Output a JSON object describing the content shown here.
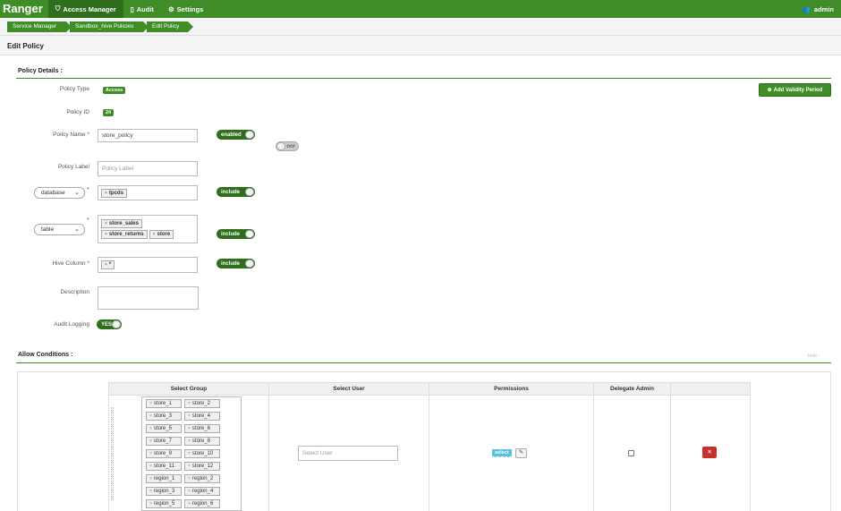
{
  "nav": {
    "brand": "Ranger",
    "items": [
      {
        "label": "Access Manager",
        "icon": "shield-icon"
      },
      {
        "label": "Audit",
        "icon": "file-icon"
      },
      {
        "label": "Settings",
        "icon": "gear-icon"
      }
    ],
    "user": "admin"
  },
  "breadcrumb": [
    "Service Manager",
    "Sandbox_hive Policies",
    "Edit Policy"
  ],
  "page_title": "Edit Policy",
  "policy_details": {
    "section_title": "Policy Details :",
    "add_validity_label": "Add Validity Period",
    "policy_type_label": "Policy Type",
    "policy_type": "Access",
    "policy_id_label": "Policy ID",
    "policy_id": "24",
    "policy_name_label": "Policy Name *",
    "policy_name": "store_policy",
    "enabled_label": "enabled",
    "normal_label": "nor",
    "policy_label_label": "Policy Label",
    "policy_label_placeholder": "Policy Label",
    "database_select": "database",
    "database_values": [
      "tpcds"
    ],
    "table_select": "table",
    "table_values": [
      "store_sales",
      "store_returns",
      "store"
    ],
    "hive_column_label": "Hive Column *",
    "hive_column_values": [
      "*"
    ],
    "include_label": "include",
    "required_mark": "*",
    "description_label": "Description",
    "audit_logging_label": "Audit Logging",
    "audit_logging_value": "YES"
  },
  "allow_conditions": {
    "section_title": "Allow Conditions :",
    "hide_label": "hide -",
    "columns": [
      "Select Group",
      "Select User",
      "Permissions",
      "Delegate Admin"
    ],
    "groups": [
      "store_1",
      "store_2",
      "store_3",
      "store_4",
      "store_5",
      "store_6",
      "store_7",
      "store_8",
      "store_9",
      "store_10",
      "store_11",
      "store_12",
      "region_1",
      "region_2",
      "region_3",
      "region_4",
      "region_5",
      "region_6"
    ],
    "user_placeholder": "Select User",
    "permission_label": "select"
  }
}
